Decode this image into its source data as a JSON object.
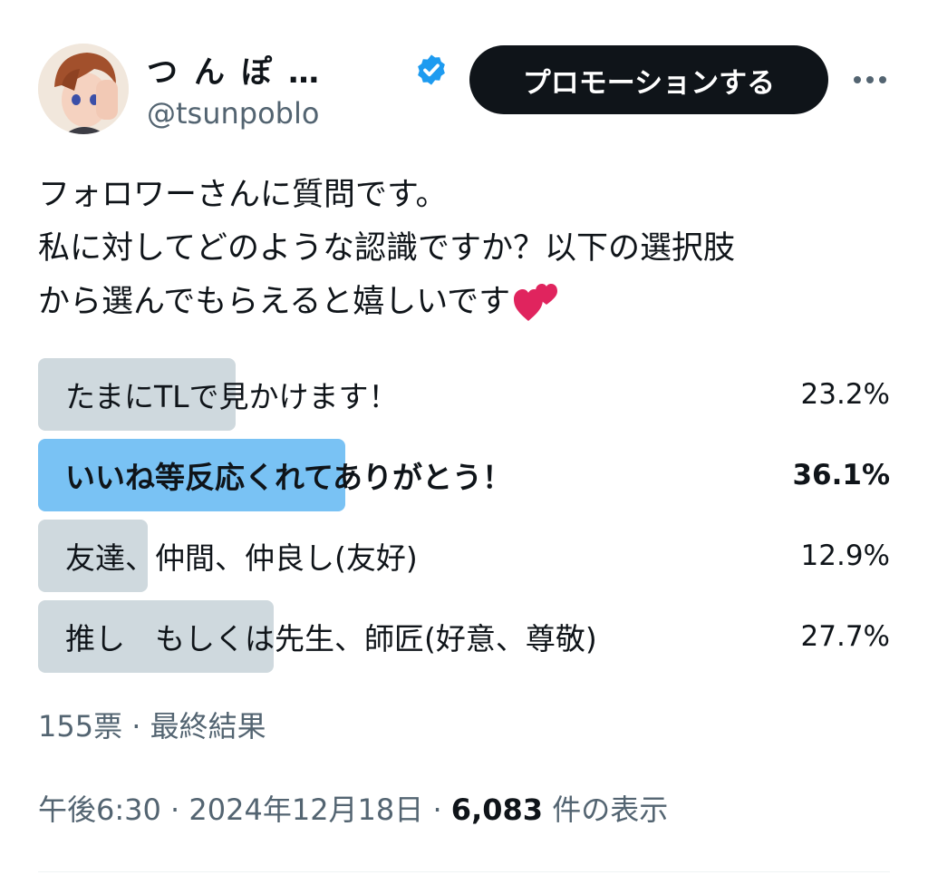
{
  "header": {
    "display_name": "つんぽ…",
    "handle": "@tsunpoblo",
    "promote_label": "プロモーションする",
    "more_label": "•••"
  },
  "tweet": {
    "text": "フォロワーさんに質問です。\n私に対してどのような認識ですか？以下の選択肢\nから選んでもらえると嬉しいです"
  },
  "poll": {
    "options": [
      {
        "label": "たまにTLで見かけます！",
        "percent": 23.2,
        "percent_text": "23.2%"
      },
      {
        "label": "いいね等反応くれてありがとう！",
        "percent": 36.1,
        "percent_text": "36.1%",
        "winner": true
      },
      {
        "label": "友達、仲間、仲良し(友好)",
        "percent": 12.9,
        "percent_text": "12.9%"
      },
      {
        "label": "推し　もしくは先生、師匠(好意、尊敬)",
        "percent": 27.7,
        "percent_text": "27.7%"
      }
    ],
    "summary": "155票 · 最終結果"
  },
  "meta": {
    "time": "午後6:30",
    "separator": "·",
    "date": "2024年12月18日",
    "views_count": "6,083",
    "views_label": "件の表示"
  },
  "colors": {
    "text": "#0f1419",
    "secondary": "#536471",
    "verified": "#1d9bf0",
    "poll_bar": "#cfd9de",
    "poll_bar_winner": "#79c2f4",
    "heart": "#e0245e"
  }
}
